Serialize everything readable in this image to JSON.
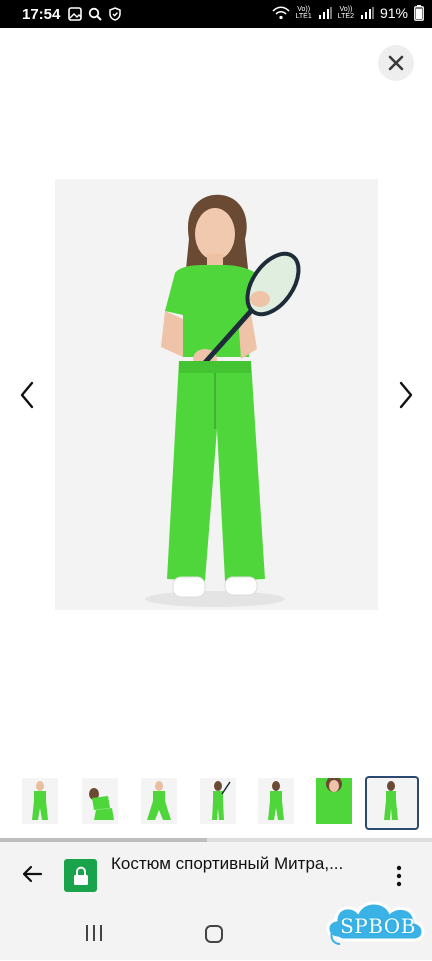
{
  "status_bar": {
    "time": "17:54",
    "carrier1_top": "Vo))",
    "carrier1_bottom": "LTE1",
    "carrier2_top": "Vo))",
    "carrier2_bottom": "LTE2",
    "battery": "91%"
  },
  "viewer": {
    "close_icon": "close-icon",
    "prev_icon": "chevron-left-icon",
    "next_icon": "chevron-right-icon",
    "thumbnails_count": 7,
    "selected_thumbnail_index": 6
  },
  "progress": {
    "fraction": 0.48
  },
  "browser": {
    "page_title": "Костюм спортивный Митра,...",
    "lock_color": "#19a34a"
  },
  "watermark": {
    "text": "SPBOB"
  },
  "colors": {
    "garment_green": "#4fd63a",
    "accent": "#2c4a6e"
  }
}
